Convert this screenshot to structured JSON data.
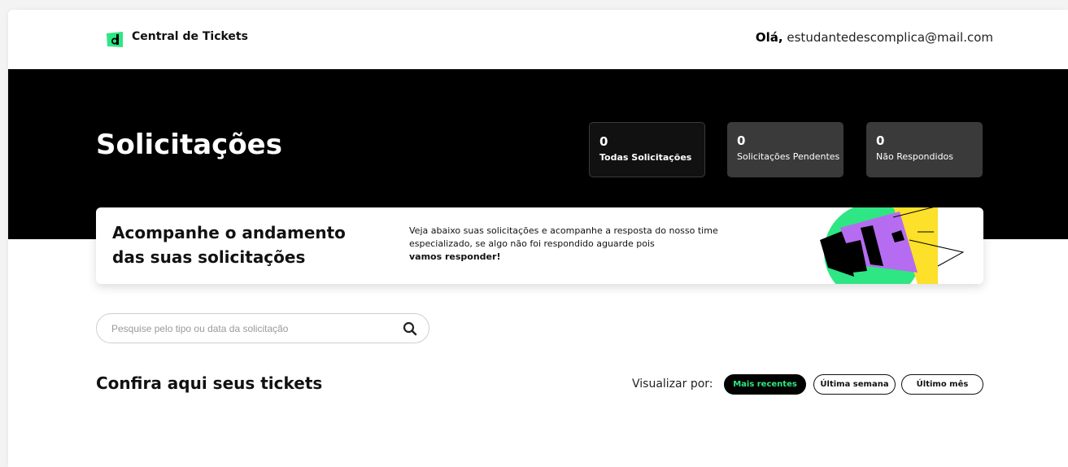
{
  "header": {
    "brand": "Central de Tickets",
    "greeting_prefix": "Olá,",
    "user_email": "estudantedescomplica@mail.com"
  },
  "hero": {
    "title": "Solicitações",
    "stats": [
      {
        "value": "0",
        "label": "Todas Solicitações"
      },
      {
        "value": "0",
        "label": "Solicitações Pendentes"
      },
      {
        "value": "0",
        "label": "Não Respondidos"
      }
    ]
  },
  "info_card": {
    "title_line1": "Acompanhe o andamento",
    "title_line2": "das suas solicitações",
    "text": "Veja abaixo suas solicitações e acompanhe a resposta do nosso time especializado, se algo não foi respondido aguarde pois",
    "text_bold": "vamos responder!"
  },
  "search": {
    "placeholder": "Pesquise pelo tipo ou data da solicitação",
    "value": ""
  },
  "tickets": {
    "title": "Confira aqui seus tickets",
    "view_by_label": "Visualizar por:",
    "filters": [
      "Mais recentes",
      "Última semana",
      "Último mês"
    ],
    "selected_filter": "Mais recentes"
  },
  "colors": {
    "accent_green": "#2ee683",
    "hero_bg": "#000000",
    "illus_purple": "#b66cf0",
    "illus_yellow": "#fce02a"
  },
  "icons": {
    "logo": "descomplica-logo-icon",
    "search": "search-icon",
    "illustration": "megaphone-illustration"
  }
}
